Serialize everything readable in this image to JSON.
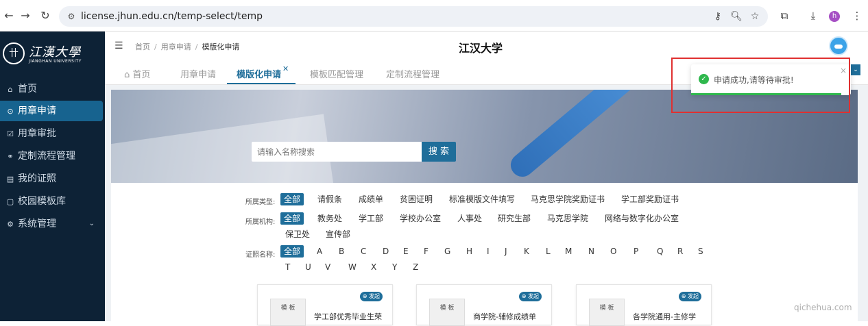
{
  "browser": {
    "url": "license.jhun.edu.cn/temp-select/temp",
    "profile_initial": "h"
  },
  "sidebar": {
    "logo_cn": "江漢大學",
    "logo_en": "JIANGHAN UNIVERSITY",
    "items": [
      {
        "label": "首页",
        "icon": "home-icon"
      },
      {
        "label": "用章申请",
        "icon": "seal-apply-icon",
        "active": true
      },
      {
        "label": "用章审批",
        "icon": "approval-icon"
      },
      {
        "label": "定制流程管理",
        "icon": "flow-icon"
      },
      {
        "label": "我的证照",
        "icon": "license-icon"
      },
      {
        "label": "校园模板库",
        "icon": "template-icon"
      },
      {
        "label": "系统管理",
        "icon": "settings-icon",
        "expandable": true
      }
    ]
  },
  "header": {
    "breadcrumb": [
      "首页",
      "用章申请",
      "模版化申请"
    ],
    "title": "江汉大学"
  },
  "tabs": [
    {
      "label": "首页",
      "icon": "home-icon"
    },
    {
      "label": "用章申请"
    },
    {
      "label": "模版化申请",
      "active": true,
      "closable": true
    },
    {
      "label": "模板匹配管理"
    },
    {
      "label": "定制流程管理"
    }
  ],
  "search": {
    "placeholder": "请输入名称搜索",
    "button_label": "搜 索"
  },
  "filters": {
    "type_label": "所属类型:",
    "types": [
      "全部",
      "请假条",
      "成绩单",
      "贫困证明",
      "标准模版文件填写",
      "马克思学院奖励证书",
      "学工部奖励证书"
    ],
    "org_label": "所属机构:",
    "orgs": [
      "全部",
      "教务处",
      "学工部",
      "学校办公室",
      "人事处",
      "研究生部",
      "马克思学院",
      "网络与数字化办公室",
      "保卫处",
      "宣传部"
    ],
    "name_label": "证照名称:",
    "letters": [
      "全部",
      "A",
      "B",
      "C",
      "D",
      "E",
      "F",
      "G",
      "H",
      "I",
      "J",
      "K",
      "L",
      "M",
      "N",
      "O",
      "P",
      "Q",
      "R",
      "S",
      "T",
      "U",
      "V",
      "W",
      "X",
      "Y",
      "Z"
    ]
  },
  "cards": [
    {
      "title": "学工部优秀毕业生荣",
      "tag": "⊕ 发起",
      "thumb": "模 板"
    },
    {
      "title": "商学院-辅修成绩单",
      "tag": "⊕ 发起",
      "thumb": "模 板"
    },
    {
      "title": "各学院通用-主修学",
      "tag": "⊕ 发起",
      "thumb": "模 板"
    }
  ],
  "notification": {
    "text": "申请成功,请等待审批!",
    "progress": 0.94
  },
  "watermark": "qichehua.com"
}
